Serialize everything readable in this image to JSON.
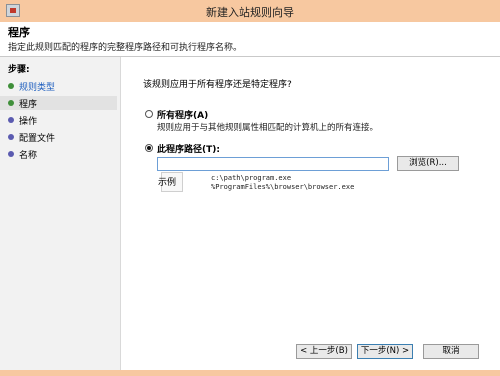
{
  "window": {
    "title": "新建入站规则向导"
  },
  "header": {
    "title": "程序",
    "description": "指定此规则匹配的程序的完整程序路径和可执行程序名称。"
  },
  "sidebar": {
    "steps_label": "步骤:",
    "steps": [
      {
        "label": "规则类型",
        "state": "done"
      },
      {
        "label": "程序",
        "state": "current"
      },
      {
        "label": "操作",
        "state": "pending"
      },
      {
        "label": "配置文件",
        "state": "pending"
      },
      {
        "label": "名称",
        "state": "pending"
      }
    ]
  },
  "main": {
    "question": "该规则应用于所有程序还是特定程序?",
    "all_programs": {
      "label": "所有程序(A)",
      "description": "规则应用于与其他规则属性相匹配的计算机上的所有连接。",
      "checked": false
    },
    "this_program": {
      "label": "此程序路径(T):",
      "checked": true,
      "value": ""
    },
    "browse_label": "浏览(R)...",
    "example_label": "示例",
    "example_paths": [
      "c:\\path\\program.exe",
      "%ProgramFiles%\\browser\\browser.exe"
    ]
  },
  "buttons": {
    "back": "< 上一步(B)",
    "next": "下一步(N) >",
    "cancel": "取消"
  },
  "icons": {
    "app": "firewall-icon"
  },
  "colors": {
    "titlebar": "#f7c8a0",
    "done_step": "#3f8f3a",
    "pending_step": "#5b5bb0"
  }
}
